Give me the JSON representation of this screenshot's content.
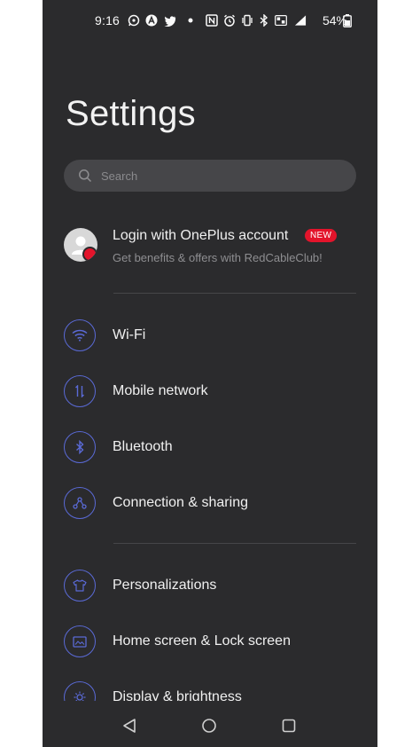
{
  "status_bar": {
    "time": "9:16",
    "battery_percent": "54%",
    "icons": [
      "whatsapp-icon",
      "a-icon",
      "twitter-icon",
      "dot-icon",
      "nfc-icon",
      "alarm-icon",
      "vibrate-icon",
      "bluetooth-icon",
      "volte-icon",
      "signal-icon",
      "battery-icon"
    ]
  },
  "page": {
    "title": "Settings"
  },
  "search": {
    "placeholder": "Search"
  },
  "account": {
    "title": "Login with OnePlus account",
    "badge": "NEW",
    "subtitle": "Get benefits & offers with RedCableClub!"
  },
  "settings_items": [
    {
      "label": "Wi-Fi",
      "icon": "wifi-icon"
    },
    {
      "label": "Mobile network",
      "icon": "mobile-network-icon"
    },
    {
      "label": "Bluetooth",
      "icon": "bluetooth-icon"
    },
    {
      "label": "Connection & sharing",
      "icon": "connection-sharing-icon"
    },
    {
      "label": "Personalizations",
      "icon": "tshirt-icon"
    },
    {
      "label": "Home screen & Lock screen",
      "icon": "home-screen-icon"
    },
    {
      "label": "Display & brightness",
      "icon": "brightness-icon"
    }
  ],
  "nav_bar": {
    "buttons": [
      "back-icon",
      "home-icon",
      "recents-icon"
    ]
  },
  "colors": {
    "background": "#2b2b2d",
    "accent_icon": "#5a6ad6",
    "badge": "#e3142b",
    "search_bg": "#464649"
  }
}
